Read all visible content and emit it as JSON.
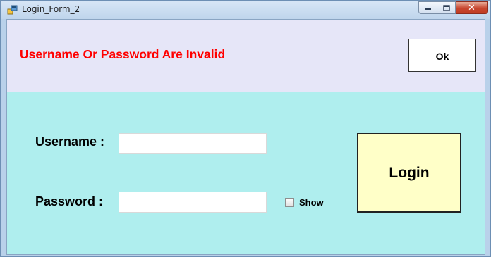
{
  "window": {
    "title": "Login_Form_2",
    "controls": {
      "minimize_icon": "minimize-icon",
      "maximize_icon": "maximize-icon",
      "close_icon": "close-icon",
      "close_symbol": "✕"
    },
    "close_color": "#c7462f"
  },
  "banner": {
    "error_message": "Username Or Password Are Invalid",
    "error_color": "#ff0000",
    "ok_label": "Ok",
    "background": "#e6e6f8"
  },
  "form": {
    "background": "#afeeee",
    "username_label": "Username :",
    "username_value": "",
    "password_label": "Password :",
    "password_value": "",
    "show_label": "Show",
    "show_checked": false,
    "login_label": "Login",
    "login_color": "#ffffc8"
  }
}
